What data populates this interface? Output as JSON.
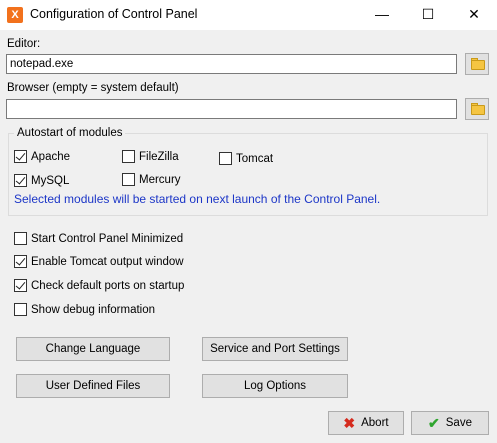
{
  "window": {
    "title": "Configuration of Control Panel",
    "app_icon_glyph": "X"
  },
  "titlebar_buttons": {
    "minimize": "—",
    "maximize": "☐",
    "close": "✕"
  },
  "editor": {
    "label": "Editor:",
    "value": "notepad.exe"
  },
  "browser": {
    "label": "Browser (empty = system default)",
    "value": ""
  },
  "autostart": {
    "legend": "Autostart of modules",
    "modules": [
      {
        "label": "Apache",
        "checked": true
      },
      {
        "label": "FileZilla",
        "checked": false
      },
      {
        "label": "Tomcat",
        "checked": false
      },
      {
        "label": "MySQL",
        "checked": true
      },
      {
        "label": "Mercury",
        "checked": false
      }
    ],
    "info": "Selected modules will be started on next launch of the Control Panel.",
    "info_color": "#1c36c7"
  },
  "options": [
    {
      "label": "Start Control Panel Minimized",
      "checked": false
    },
    {
      "label": "Enable Tomcat output window",
      "checked": true
    },
    {
      "label": "Check default ports on startup",
      "checked": true
    },
    {
      "label": "Show debug information",
      "checked": false
    }
  ],
  "buttons": {
    "change_language": "Change Language",
    "service_port": "Service and Port Settings",
    "user_files": "User Defined Files",
    "log_options": "Log Options",
    "abort": "Abort",
    "save": "Save"
  },
  "icons": {
    "abort": "✖",
    "save": "✔"
  }
}
